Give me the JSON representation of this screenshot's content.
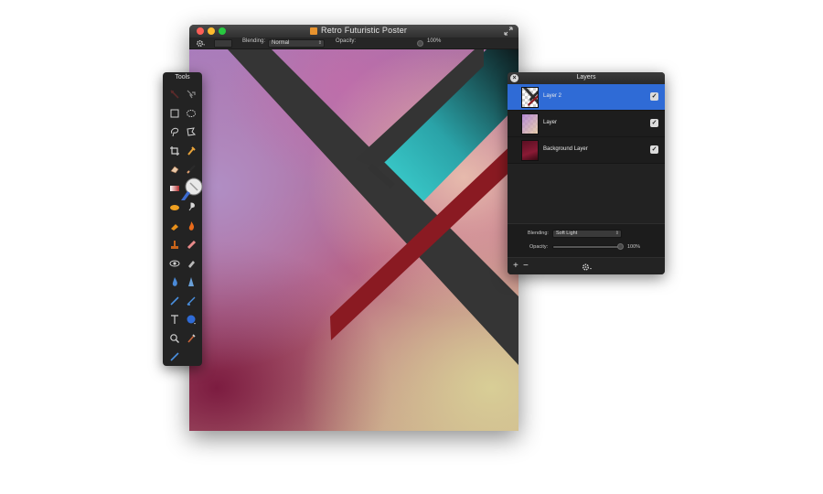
{
  "document": {
    "title": "Retro Futuristic Poster",
    "options": {
      "blending_label": "Blending:",
      "blending_value": "Normal",
      "opacity_label": "Opacity:",
      "opacity_value": "100%"
    }
  },
  "tools": {
    "title": "Tools",
    "items": [
      "move-icon",
      "arrange-icon",
      "rectangle-select-icon",
      "ellipse-select-icon",
      "lasso-select-icon",
      "polygon-lasso-icon",
      "crop-icon",
      "eyedropper-icon",
      "eraser-icon",
      "pencil-icon",
      "gradient-icon",
      "brush-icon",
      "smudge-icon",
      "sharpen-icon",
      "paint-bucket-icon",
      "burn-icon",
      "clone-stamp-icon",
      "heal-icon",
      "red-eye-icon",
      "patch-icon",
      "blur-icon",
      "sponge-icon",
      "line-icon",
      "pen-icon",
      "text-icon",
      "shape-icon",
      "zoom-icon",
      "hand-icon",
      "color-picker-icon"
    ]
  },
  "layers": {
    "title": "Layers",
    "items": [
      {
        "name": "Layer 2",
        "selected": true,
        "visible": true
      },
      {
        "name": "Layer",
        "selected": false,
        "visible": true
      },
      {
        "name": "Background Layer",
        "selected": false,
        "visible": true
      }
    ],
    "blending_label": "Blending:",
    "blending_value": "Soft Light",
    "opacity_label": "Opacity:",
    "opacity_value": "100%",
    "opacity_fraction": 1.0,
    "add_label": "+",
    "remove_label": "−"
  },
  "colors": {
    "selection_blue": "#2f6bd6",
    "stripe_dark": "#353535",
    "stripe_red": "#8a1a22",
    "teal": "#3ed6d4"
  }
}
